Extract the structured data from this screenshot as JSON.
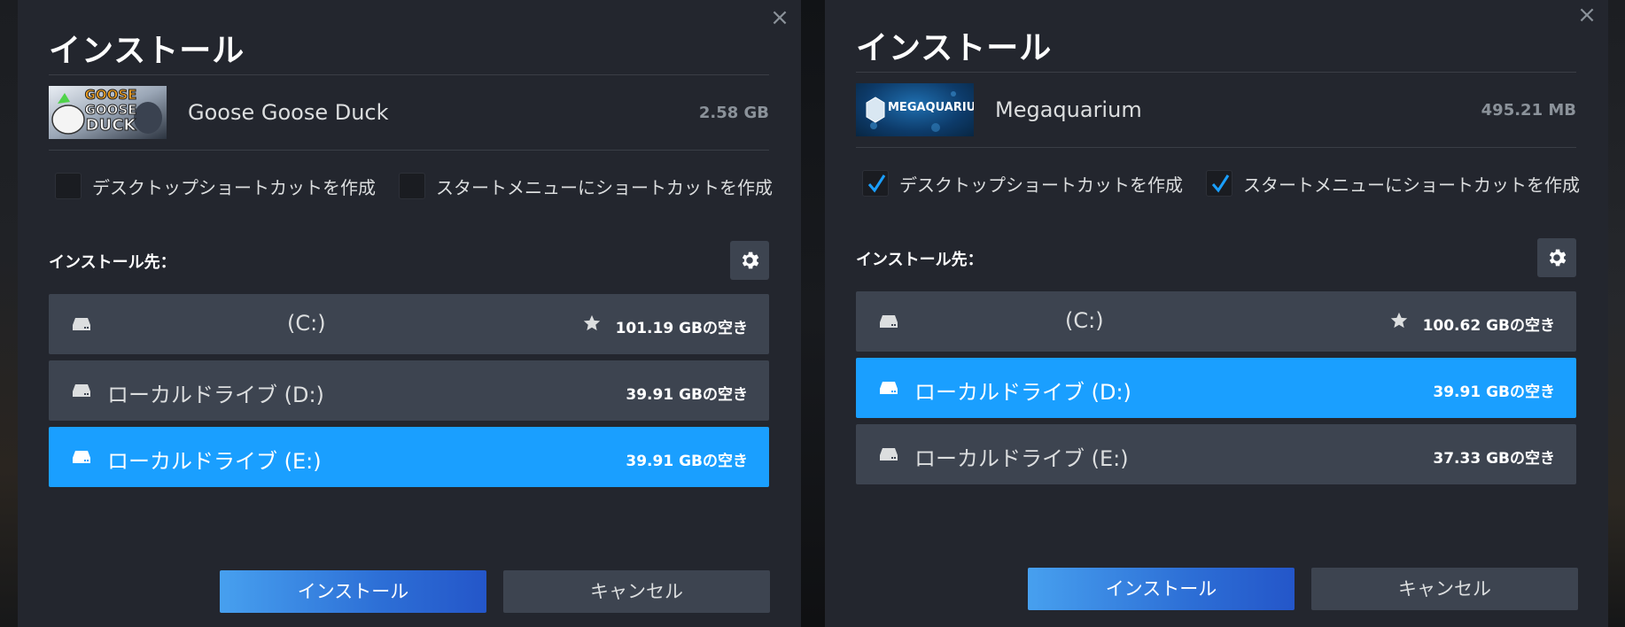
{
  "colors": {
    "accent": "#1a9fff",
    "dialog_bg": "#23262e",
    "row_bg": "#3d4450"
  },
  "dialogs": [
    {
      "title": "インストール",
      "game": {
        "name": "Goose Goose Duck",
        "size": "2.58 GB",
        "thumb_icon": "goose-goose-duck-logo"
      },
      "options": [
        {
          "label": "デスクトップショートカットを作成",
          "checked": false
        },
        {
          "label": "スタートメニューにショートカットを作成",
          "checked": false
        }
      ],
      "destination_label": "インストール先：",
      "drives": [
        {
          "name": "(C:)",
          "free": "101.19 GBの空き",
          "default": true,
          "selected": false
        },
        {
          "name": "ローカルドライブ (D:)",
          "free": "39.91 GBの空き",
          "default": false,
          "selected": false
        },
        {
          "name": "ローカルドライブ (E:)",
          "free": "39.91 GBの空き",
          "default": false,
          "selected": true
        }
      ],
      "install_label": "インストール",
      "cancel_label": "キャンセル"
    },
    {
      "title": "インストール",
      "game": {
        "name": "Megaquarium",
        "size": "495.21 MB",
        "thumb_icon": "megaquarium-logo",
        "thumb_text": "MEGAQUARIUM"
      },
      "options": [
        {
          "label": "デスクトップショートカットを作成",
          "checked": true
        },
        {
          "label": "スタートメニューにショートカットを作成",
          "checked": true
        }
      ],
      "destination_label": "インストール先：",
      "drives": [
        {
          "name": "(C:)",
          "free": "100.62 GBの空き",
          "default": true,
          "selected": false
        },
        {
          "name": "ローカルドライブ (D:)",
          "free": "39.91 GBの空き",
          "default": false,
          "selected": true
        },
        {
          "name": "ローカルドライブ (E:)",
          "free": "37.33 GBの空き",
          "default": false,
          "selected": false
        }
      ],
      "install_label": "インストール",
      "cancel_label": "キャンセル"
    }
  ],
  "left_thumb_text": [
    "GOOSE",
    "GOOSE",
    "DUCK"
  ]
}
